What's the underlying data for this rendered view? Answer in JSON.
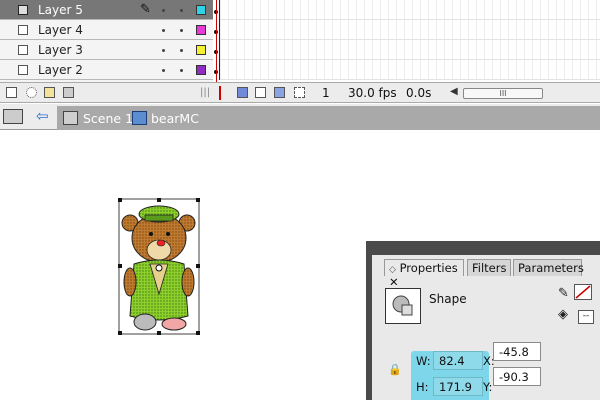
{
  "timeline": {
    "layers": [
      {
        "name": "Layer 5",
        "selected": true,
        "color": "#2fd3e8"
      },
      {
        "name": "Layer 4",
        "selected": false,
        "color": "#ea3ad6"
      },
      {
        "name": "Layer 3",
        "selected": false,
        "color": "#f4ef2f"
      },
      {
        "name": "Layer 2",
        "selected": false,
        "color": "#8f2cc3"
      }
    ],
    "status": {
      "frame": "1",
      "fps": "30.0 fps",
      "time": "0.0s",
      "scroll_grip": "III"
    }
  },
  "editbar": {
    "scene": "Scene 1",
    "symbol": "bearMC"
  },
  "properties": {
    "tabs": [
      "Properties",
      "Filters",
      "Parameters"
    ],
    "active_tab": "Properties",
    "close_glyph": "✕",
    "type": "Shape",
    "w_label": "W:",
    "w_value": "82.4",
    "h_label": "H:",
    "h_value": "171.9",
    "x_label": "X:",
    "x_value": "-45.8",
    "y_label": "Y:",
    "y_value": "-90.3",
    "stroke_dropdown": "--"
  },
  "icons": [
    "pencil-icon",
    "layer-icon",
    "playhead-icon",
    "back-arrow-icon",
    "scene-icon",
    "movieclip-icon",
    "lock-icon",
    "stroke-color-icon",
    "fill-color-icon"
  ]
}
